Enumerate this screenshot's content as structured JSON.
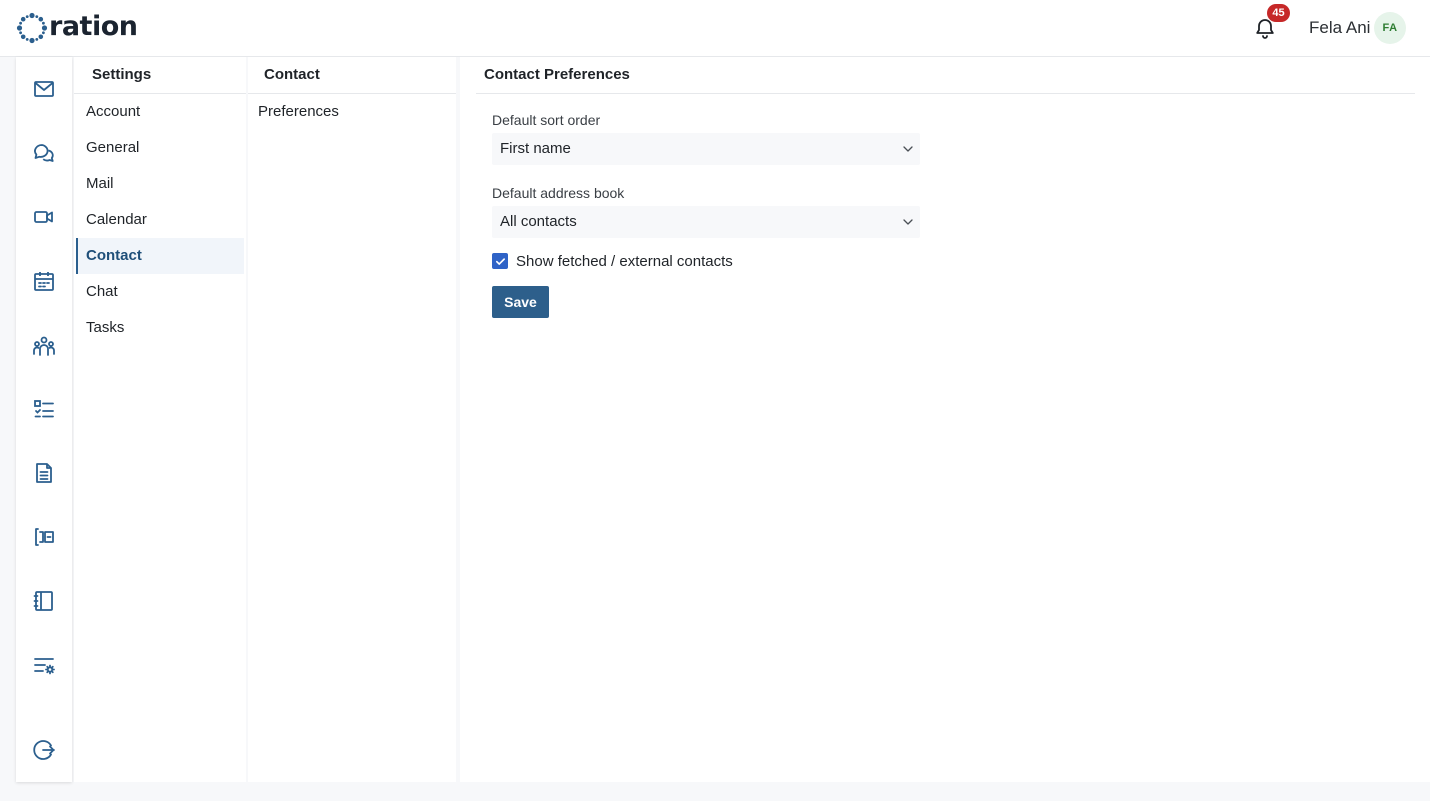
{
  "brand": {
    "name": "ration",
    "color": "#2b5f8e"
  },
  "header": {
    "notifications_count": "45",
    "user_name": "Fela Ani",
    "user_initials": "FA",
    "icons": [
      "bell-icon"
    ]
  },
  "rail": {
    "icons": [
      "mail-icon",
      "chat-icon",
      "video-icon",
      "calendar-icon",
      "team-icon",
      "tasks-list-icon",
      "document-icon",
      "board-icon",
      "notebook-icon",
      "settings-list-icon",
      "logout-icon"
    ]
  },
  "settings": {
    "title": "Settings",
    "items": [
      {
        "label": "Account",
        "active": false
      },
      {
        "label": "General",
        "active": false
      },
      {
        "label": "Mail",
        "active": false
      },
      {
        "label": "Calendar",
        "active": false
      },
      {
        "label": "Contact",
        "active": true
      },
      {
        "label": "Chat",
        "active": false
      },
      {
        "label": "Tasks",
        "active": false
      }
    ]
  },
  "contact": {
    "title": "Contact",
    "items": [
      {
        "label": "Preferences"
      }
    ]
  },
  "preferences": {
    "title": "Contact Preferences",
    "sort_order_label": "Default sort order",
    "sort_order_value": "First name",
    "address_book_label": "Default address book",
    "address_book_value": "All contacts",
    "show_external_label": "Show fetched / external contacts",
    "show_external_checked": true,
    "save_label": "Save"
  },
  "colors": {
    "accent": "#2d5f8b",
    "checkbox": "#2f63c7",
    "badge": "#c62828",
    "avatar_bg": "#e6f4ea",
    "avatar_text": "#2e7d32"
  }
}
